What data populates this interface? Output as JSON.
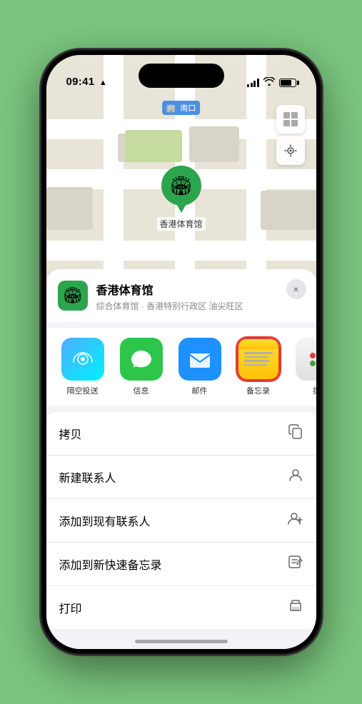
{
  "status_bar": {
    "time": "09:41",
    "location_arrow": "▲"
  },
  "map": {
    "location_badge": "南口",
    "pin_label": "香港体育馆",
    "controls": {
      "map_view": "🗺",
      "location": "➤"
    }
  },
  "place_header": {
    "name": "香港体育馆",
    "subtitle": "综合体育馆 · 香港特别行政区 油尖旺区",
    "close_label": "×"
  },
  "share_items": [
    {
      "id": "airdrop",
      "label": "隔空投送"
    },
    {
      "id": "messages",
      "label": "信息"
    },
    {
      "id": "mail",
      "label": "邮件"
    },
    {
      "id": "notes",
      "label": "备忘录"
    },
    {
      "id": "more",
      "label": "提"
    }
  ],
  "actions": [
    {
      "label": "拷贝",
      "icon": "copy"
    },
    {
      "label": "新建联系人",
      "icon": "person"
    },
    {
      "label": "添加到现有联系人",
      "icon": "person-add"
    },
    {
      "label": "添加到新快速备忘录",
      "icon": "note"
    },
    {
      "label": "打印",
      "icon": "print"
    }
  ]
}
